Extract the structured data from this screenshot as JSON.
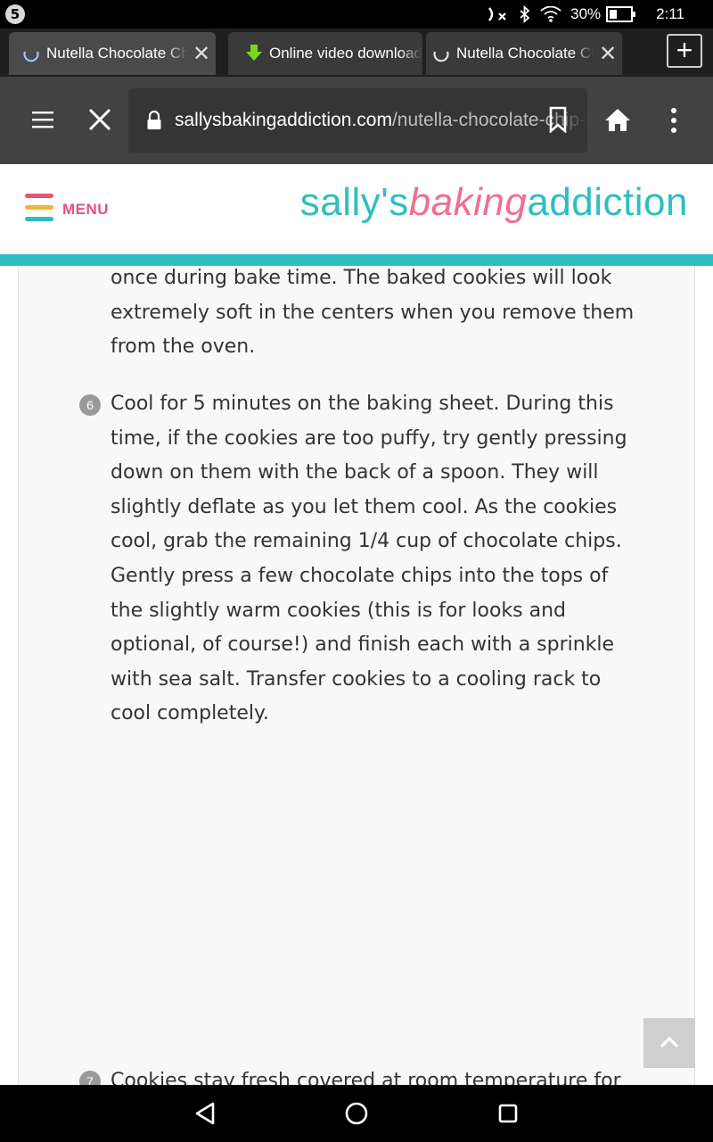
{
  "status_bar": {
    "notification_count": "5",
    "battery_percent": "30%",
    "time": "2:11",
    "icons": [
      "nfc-off-icon",
      "bluetooth-icon",
      "wifi-icon",
      "battery-icon"
    ]
  },
  "tabs": [
    {
      "label": "Nutella Chocolate Chip Cookies",
      "icon": "loading-spinner-icon",
      "closable": true,
      "active": true
    },
    {
      "label": "Online video downloader",
      "icon": "download-arrow-icon",
      "closable": false,
      "active": false
    },
    {
      "label": "Nutella Chocolate Chip Cookies",
      "icon": "loading-spinner-icon",
      "closable": true,
      "active": false
    }
  ],
  "new_tab_label": "+",
  "toolbar": {
    "url_domain": "sallysbakingaddiction.com",
    "url_path": "/nutella-chocolate-chip-cookies/"
  },
  "site": {
    "menu_label": "MENU",
    "logo_part1": "sally's",
    "logo_part2": "baking",
    "logo_part3": "addiction",
    "accent_color": "#2fbec0",
    "pink_color": "#e8527d"
  },
  "recipe": {
    "step5_tail": "once during bake time. The baked cookies will look extremely soft in the centers when you remove them from the oven.",
    "step6_num": "6",
    "step6_text": "Cool for 5 minutes on the baking sheet. During this time, if the cookies are too puffy, try gently pressing down on them with the back of a spoon. They will slightly deflate as you let them cool. As the cookies cool, grab the remaining 1/4 cup of chocolate chips. Gently press a few chocolate chips into the tops of the slightly warm cookies (this is for looks and optional, of course!) and finish each with a sprinkle with sea salt. Transfer cookies to a cooling rack to cool completely.",
    "step7_num": "7",
    "step7_text": "Cookies stay fresh covered at room temperature for"
  }
}
